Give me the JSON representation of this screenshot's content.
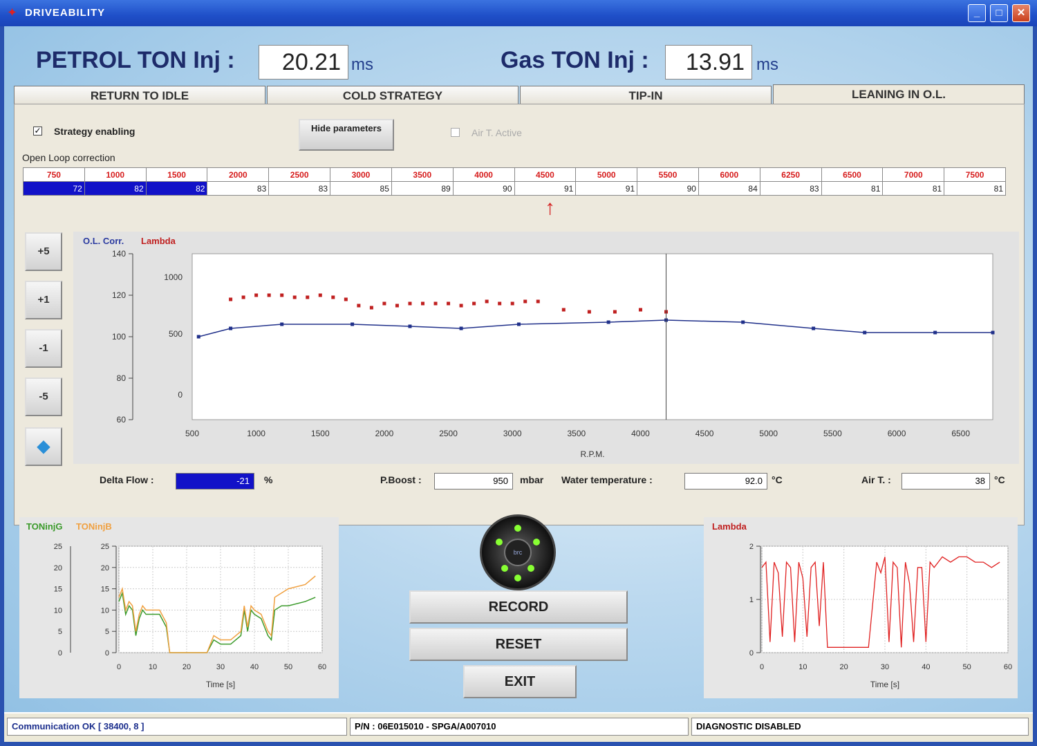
{
  "window": {
    "title": "DRIVEABILITY"
  },
  "header": {
    "petrol_label": "PETROL TON Inj :",
    "petrol_value": "20.21",
    "petrol_unit": "ms",
    "gas_label": "Gas TON Inj :",
    "gas_value": "13.91",
    "gas_unit": "ms"
  },
  "tabs": [
    {
      "label": "RETURN TO IDLE"
    },
    {
      "label": "COLD STRATEGY"
    },
    {
      "label": "TIP-IN"
    },
    {
      "label": "LEANING IN O.L."
    }
  ],
  "controls": {
    "strategy_enabling": "Strategy enabling",
    "strategy_checked": "✓",
    "hide_parameters": "Hide parameters",
    "air_active": "Air T. Active",
    "open_loop_label": "Open Loop correction"
  },
  "correction_table": {
    "rpm": [
      "750",
      "1000",
      "1500",
      "2000",
      "2500",
      "3000",
      "3500",
      "4000",
      "4500",
      "5000",
      "5500",
      "6000",
      "6250",
      "6500",
      "7000",
      "7500"
    ],
    "values": [
      "72",
      "82",
      "82",
      "83",
      "83",
      "85",
      "89",
      "90",
      "91",
      "91",
      "90",
      "84",
      "83",
      "81",
      "81",
      "81"
    ]
  },
  "side_buttons": [
    "+5",
    "+1",
    "-1",
    "-5"
  ],
  "main_chart": {
    "legend1": "O.L. Corr.",
    "legend2": "Lambda",
    "xlabel": "R.P.M.",
    "left_ticks": [
      "140",
      "120",
      "100",
      "80",
      "60"
    ],
    "inner_ticks": [
      "1000",
      "500",
      "0"
    ]
  },
  "bottom_fields": {
    "delta_flow_label": "Delta Flow :",
    "delta_flow_value": "-21",
    "delta_flow_unit": "%",
    "pboost_label": "P.Boost :",
    "pboost_value": "950",
    "pboost_unit": "mbar",
    "water_label": "Water temperature :",
    "water_value": "92.0",
    "water_unit": "°C",
    "air_label": "Air T. :",
    "air_value": "38",
    "air_unit": "°C"
  },
  "mini_chart_1": {
    "legend1": "TONinjG",
    "legend2": "TONinjB",
    "xlabel": "Time [s]"
  },
  "mini_chart_2": {
    "legend1": "Lambda",
    "xlabel": "Time [s]"
  },
  "buttons": {
    "record": "RECORD",
    "reset": "RESET",
    "exit": "EXIT"
  },
  "status": {
    "comm": "Communication OK [ 38400, 8 ]",
    "pn": "P/N : 06E015010 - SPGA/A007010",
    "diag": "DIAGNOSTIC DISABLED"
  },
  "chart_data": [
    {
      "type": "line",
      "xlabel": "R.P.M.",
      "xlim": [
        500,
        6750
      ],
      "x_ticks": [
        500,
        1000,
        1500,
        2000,
        2500,
        3000,
        3500,
        4000,
        4500,
        5000,
        5500,
        6000,
        6500
      ],
      "ylim": [
        60,
        140
      ],
      "y_ticks": [
        60,
        80,
        100,
        120,
        140
      ],
      "series": [
        {
          "name": "O.L. Corr.",
          "x": [
            550,
            800,
            1200,
            1750,
            2200,
            2600,
            3050,
            3750,
            4200,
            4800,
            5350,
            5750,
            6300,
            6750
          ],
          "y": [
            100,
            104,
            106,
            106,
            105,
            104,
            106,
            107,
            108,
            107,
            104,
            102,
            102,
            102
          ]
        },
        {
          "name": "Lambda",
          "x": [
            800,
            900,
            1000,
            1100,
            1200,
            1300,
            1400,
            1500,
            1600,
            1700,
            1800,
            1900,
            2000,
            2100,
            2200,
            2300,
            2400,
            2500,
            2600,
            2700,
            2800,
            2900,
            3000,
            3100,
            3200,
            3400,
            3600,
            3800,
            4000,
            4200
          ],
          "y": [
            118,
            119,
            120,
            120,
            120,
            119,
            119,
            120,
            119,
            118,
            115,
            114,
            116,
            115,
            116,
            116,
            116,
            116,
            115,
            116,
            117,
            116,
            116,
            117,
            117,
            113,
            112,
            112,
            113,
            112
          ]
        }
      ]
    },
    {
      "type": "line",
      "xlabel": "Time [s]",
      "xlim": [
        0,
        60
      ],
      "x_ticks": [
        0,
        10,
        20,
        30,
        40,
        50,
        60
      ],
      "ylim": [
        0,
        25
      ],
      "y_ticks": [
        0,
        5,
        10,
        15,
        20,
        25
      ],
      "series": [
        {
          "name": "TONinjG",
          "x": [
            0,
            1,
            2,
            3,
            4,
            5,
            6,
            7,
            8,
            10,
            12,
            14,
            15,
            16,
            26,
            28,
            30,
            33,
            36,
            37,
            38,
            39,
            40,
            42,
            44,
            45,
            46,
            48,
            50,
            55,
            58
          ],
          "y": [
            12,
            14,
            9,
            11,
            10,
            4,
            8,
            10,
            9,
            9,
            9,
            6,
            0,
            0,
            0,
            3,
            2,
            2,
            4,
            10,
            5,
            10,
            9,
            8,
            4,
            3,
            10,
            11,
            11,
            12,
            13
          ]
        },
        {
          "name": "TONinjB",
          "x": [
            0,
            1,
            2,
            3,
            4,
            5,
            6,
            7,
            8,
            10,
            12,
            14,
            15,
            16,
            26,
            28,
            30,
            33,
            36,
            37,
            38,
            39,
            40,
            42,
            44,
            45,
            46,
            48,
            50,
            55,
            58
          ],
          "y": [
            13,
            15,
            10,
            12,
            11,
            5,
            9,
            11,
            10,
            10,
            10,
            7,
            0,
            0,
            0,
            4,
            3,
            3,
            5,
            11,
            6,
            11,
            10,
            9,
            5,
            4,
            13,
            14,
            15,
            16,
            18
          ]
        }
      ]
    },
    {
      "type": "line",
      "xlabel": "Time [s]",
      "xlim": [
        0,
        60
      ],
      "x_ticks": [
        0,
        10,
        20,
        30,
        40,
        50,
        60
      ],
      "ylim": [
        0,
        2
      ],
      "y_ticks": [
        0,
        1,
        2
      ],
      "series": [
        {
          "name": "Lambda",
          "x": [
            0,
            1,
            2,
            3,
            4,
            5,
            6,
            7,
            8,
            9,
            10,
            11,
            12,
            13,
            14,
            15,
            16,
            18,
            20,
            22,
            24,
            26,
            28,
            29,
            30,
            31,
            32,
            33,
            34,
            35,
            36,
            37,
            38,
            39,
            40,
            41,
            42,
            44,
            46,
            48,
            50,
            52,
            54,
            56,
            58
          ],
          "y": [
            1.6,
            1.7,
            0.2,
            1.7,
            1.5,
            0.3,
            1.7,
            1.6,
            0.2,
            1.7,
            1.4,
            0.3,
            1.6,
            1.7,
            0.5,
            1.7,
            0.1,
            0.1,
            0.1,
            0.1,
            0.1,
            0.1,
            1.7,
            1.5,
            1.8,
            0.2,
            1.7,
            1.6,
            0.1,
            1.7,
            1.3,
            0.2,
            1.6,
            1.6,
            0.2,
            1.7,
            1.6,
            1.8,
            1.7,
            1.8,
            1.8,
            1.7,
            1.7,
            1.6,
            1.7
          ]
        }
      ]
    }
  ]
}
